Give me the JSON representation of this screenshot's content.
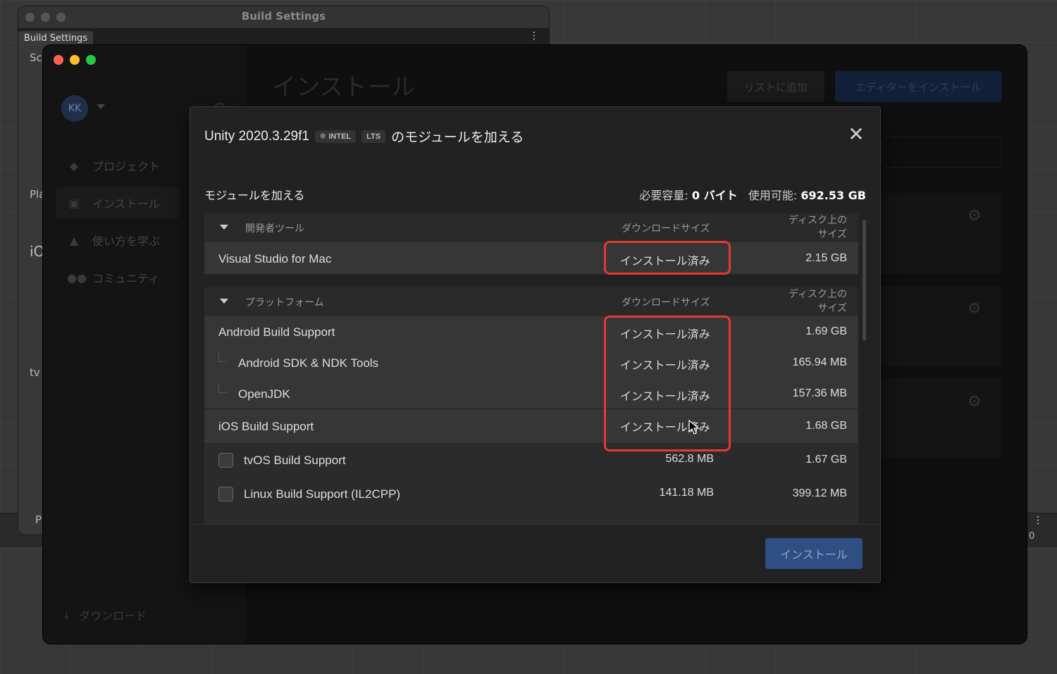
{
  "build_settings": {
    "title": "Build Settings",
    "tab_label": "Build Settings",
    "snippets": [
      "Sc",
      "Pla",
      "iO",
      "tv",
      "P"
    ]
  },
  "hub": {
    "avatar_initials": "KK",
    "nav": [
      "プロジェクト",
      "インストール",
      "使い方を学ぶ",
      "コミュニティ"
    ],
    "download_label": "ダウンロード",
    "page_title": "インストール",
    "add_to_list_label": "リストに追加",
    "install_editor_label": "エディターをインストール"
  },
  "background": {
    "menu_glyph": "⋮",
    "count": "0"
  },
  "modal": {
    "title_main": "Unity 2020.3.29f1",
    "chip_intel": "INTEL",
    "chip_lts": "LTS",
    "title_tail": "のモジュールを加える",
    "section_label": "モジュールを加える",
    "required_label": "必要容量:",
    "required_value": "0 バイト",
    "available_label": "使用可能:",
    "available_value": "692.53 GB",
    "install_button": "インストール",
    "groups": [
      {
        "title": "開発者ツール",
        "col_download": "ダウンロードサイズ",
        "col_disk_1": "ディスク上の",
        "col_disk_2": "サイズ",
        "rows": [
          {
            "name": "Visual Studio for Mac",
            "download": "インストール済み",
            "disk": "2.15 GB"
          }
        ]
      },
      {
        "title": "プラットフォーム",
        "col_download": "ダウンロードサイズ",
        "col_disk_1": "ディスク上の",
        "col_disk_2": "サイズ",
        "rows": [
          {
            "name": "Android Build Support",
            "download": "インストール済み",
            "disk": "1.69 GB"
          },
          {
            "name": "Android SDK & NDK Tools",
            "download": "インストール済み",
            "disk": "165.94 MB"
          },
          {
            "name": "OpenJDK",
            "download": "インストール済み",
            "disk": "157.36 MB"
          },
          {
            "name": "iOS Build Support",
            "download": "インストール済み",
            "disk": "1.68 GB"
          },
          {
            "name": "tvOS Build Support",
            "download": "562.8 MB",
            "disk": "1.67 GB",
            "checked": false
          },
          {
            "name": "Linux Build Support (IL2CPP)",
            "download": "141.18 MB",
            "disk": "399.12 MB",
            "checked": false
          }
        ]
      }
    ]
  },
  "colors": {
    "highlight": "#e53935",
    "install_button_bg": "#2f4e83",
    "traffic_red": "#ff5f57",
    "traffic_yellow": "#febc2e",
    "traffic_green": "#28c840"
  }
}
